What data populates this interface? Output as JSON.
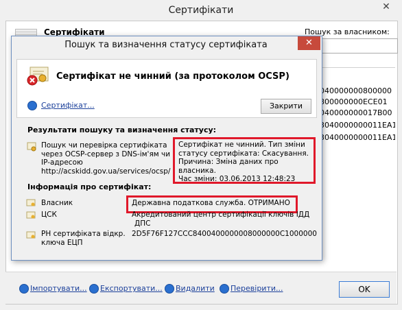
{
  "outer_window": {
    "title": "Сертифікати",
    "close_glyph": "✕",
    "heading": "Сертифікати",
    "search_label": "Пошук за власником:",
    "search_value": "",
    "list_rows": [
      "040000000800000",
      "800000000ECE01",
      "040000000017B00",
      "3040000000011EA1",
      "3040000000011EA1"
    ],
    "footer": {
      "import_label": "Імпортувати...",
      "export_label": "Експортувати...",
      "delete_label": "Видалити",
      "verify_label": "Перевірити...",
      "ok_label": "OK"
    }
  },
  "dialog": {
    "title": "Пошук та визначення статусу сертифіката",
    "close_glyph": "✕",
    "status_heading": "Сертифікат не чинний (за протоколом OCSP)",
    "cert_link": "Сертифікат...",
    "close_button": "Закрити",
    "results_heading": "Результати пошуку та визначення статусу:",
    "check_text_lines": [
      "Пошук чи перевірка сертифіката",
      "через OCSP-сервер з DNS-ім'ям чи",
      "IP-адресою",
      "http://acskidd.gov.ua/services/ocsp/"
    ],
    "status_lines": [
      "Сертифікат не чинний. Тип зміни",
      "статусу сертифіката: Скасування.",
      "Причина: Зміна даних про власника.",
      "Час зміни: 03.06.2013 12:48:23"
    ],
    "info_heading": "Інформація про сертифікат:",
    "owner_label": "Власник",
    "owner_value": "Державна податкова служба. ОТРИМАНО",
    "csk_label": "ЦСК",
    "csk_value_lines": [
      "Акредитований центр сертифікації ключів ІДД",
      "ДПС"
    ],
    "serial_label_lines": [
      "РН сертифіката відкр.",
      "ключа ЕЦП"
    ],
    "serial_value": "2D5F76F127CCC8400400000008000000C1000000"
  },
  "colors": {
    "highlight": "#e0182a",
    "link": "#1a3f9a",
    "close_red": "#c74a3c"
  }
}
